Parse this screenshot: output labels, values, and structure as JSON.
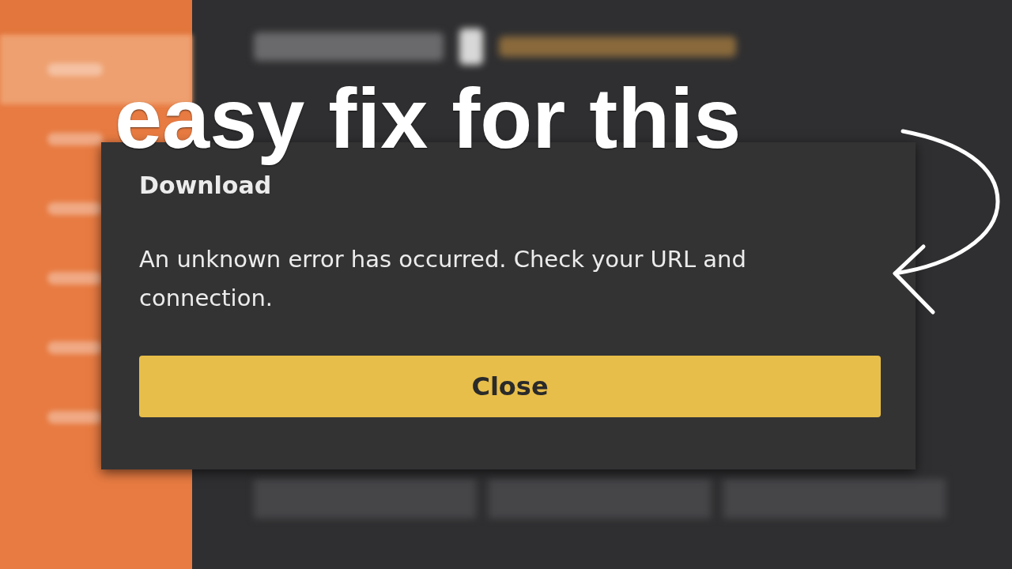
{
  "sidebar": {
    "items": [
      {
        "selected": true
      },
      {
        "selected": false
      },
      {
        "selected": false
      },
      {
        "selected": false
      },
      {
        "selected": false
      },
      {
        "selected": false
      }
    ]
  },
  "caption": "easy fix for this",
  "dialog": {
    "title": "Download",
    "message": "An unknown error has occurred. Check your URL and connection.",
    "button": "Close"
  }
}
